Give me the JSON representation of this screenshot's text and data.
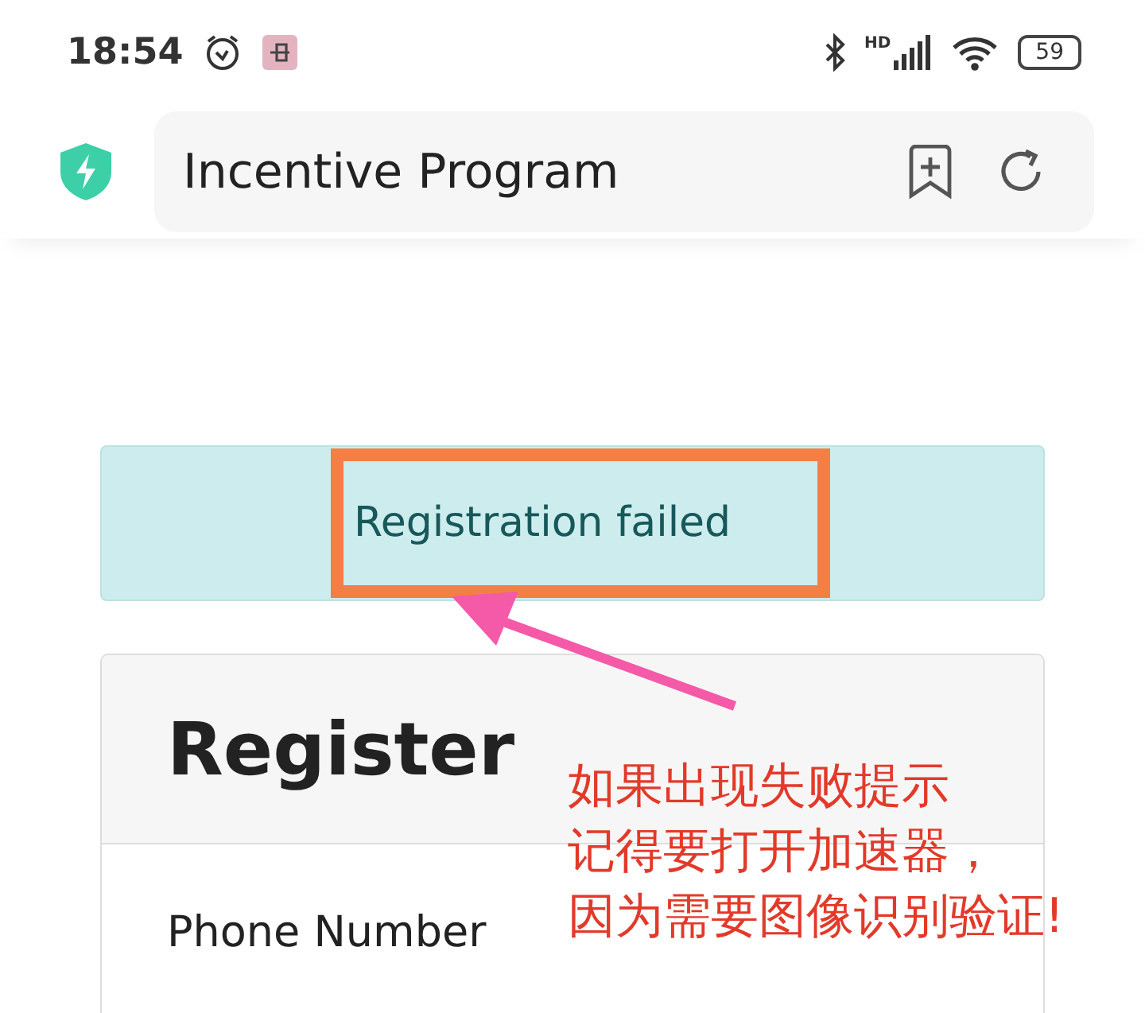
{
  "status_bar": {
    "time": "18:54",
    "network_label": "HD",
    "battery": "59"
  },
  "address_bar": {
    "title": "Incentive Program"
  },
  "alert": {
    "message": "Registration failed"
  },
  "register_card": {
    "title": "Register",
    "field_label": "Phone Number"
  },
  "annotation": {
    "lines": [
      "如果出现失败提示",
      "记得要打开加速器，",
      "因为需要图像识别验证!"
    ]
  }
}
